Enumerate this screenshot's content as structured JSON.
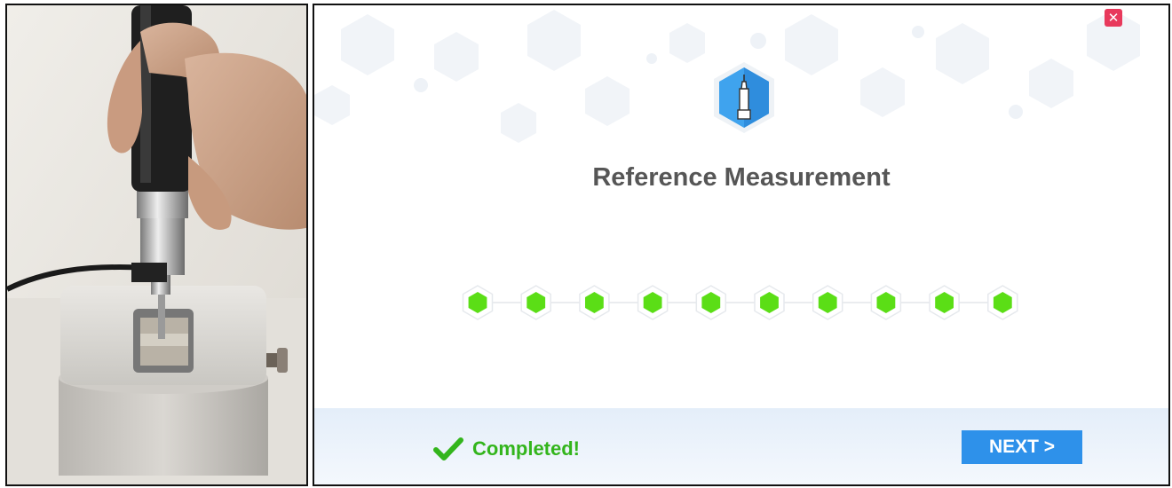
{
  "photo": {
    "description_icon": "hardness-tester-probe-photo"
  },
  "dialog": {
    "close_icon": "close-icon",
    "hero_icon": "pen-probe-icon",
    "title": "Reference Measurement",
    "progress": {
      "total_steps": 10,
      "completed_steps": 10,
      "step_color": "#5bde16"
    },
    "status": {
      "icon": "checkmark-icon",
      "text": "Completed!",
      "color": "#33b51c"
    },
    "next_label": "NEXT >",
    "accent_color": "#2e91ea"
  }
}
